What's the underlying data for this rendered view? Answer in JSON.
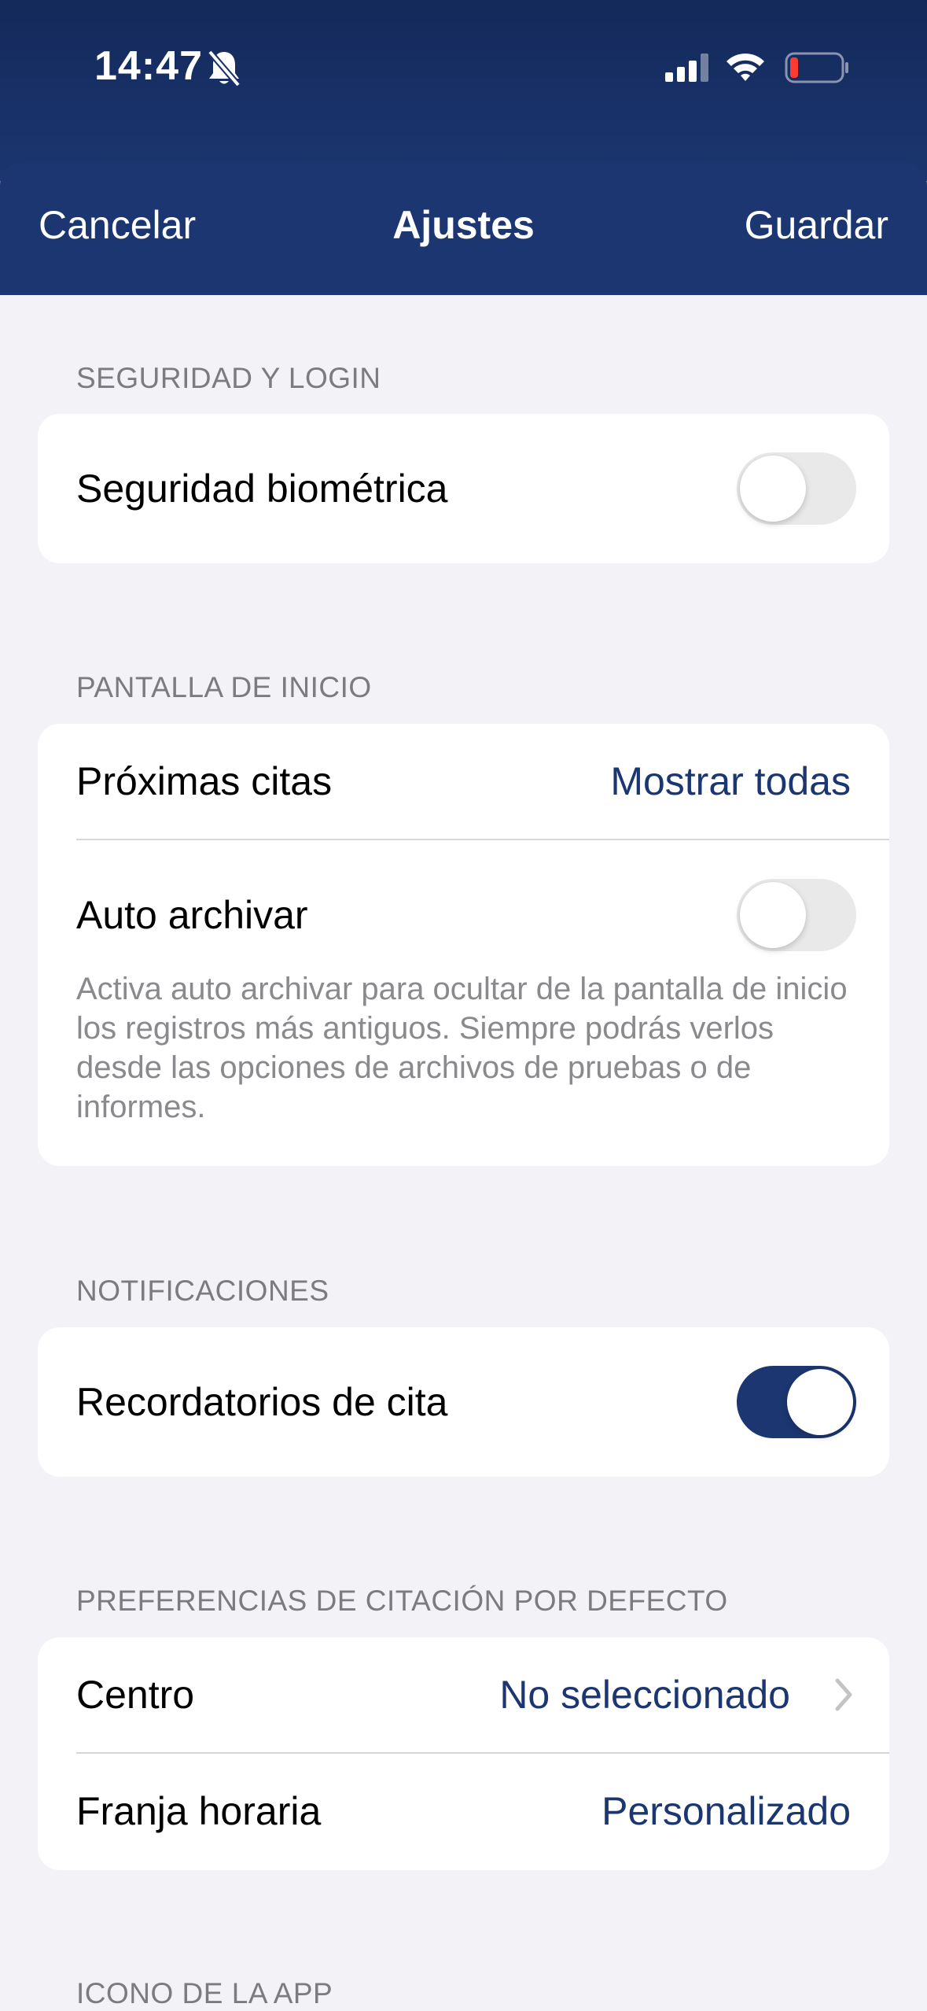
{
  "status_bar": {
    "time": "14:47"
  },
  "header": {
    "cancel_label": "Cancelar",
    "title": "Ajustes",
    "save_label": "Guardar"
  },
  "sections": {
    "security": {
      "label": "SEGURIDAD Y LOGIN",
      "biometric": {
        "label": "Seguridad biométrica",
        "enabled": false
      }
    },
    "home": {
      "label": "PANTALLA DE INICIO",
      "appointments": {
        "label": "Próximas citas",
        "value": "Mostrar todas"
      },
      "auto_archive": {
        "label": "Auto archivar",
        "enabled": false,
        "note": "Activa auto archivar para ocultar de la pantalla de inicio los registros más antiguos. Siempre podrás verlos desde las opciones de archivos de pruebas o de informes."
      }
    },
    "notifications": {
      "label": "NOTIFICACIONES",
      "reminders": {
        "label": "Recordatorios de cita",
        "enabled": true
      }
    },
    "defaults": {
      "label": "PREFERENCIAS DE CITACIÓN POR DEFECTO",
      "center": {
        "label": "Centro",
        "value": "No seleccionado"
      },
      "time_slot": {
        "label": "Franja horaria",
        "value": "Personalizado"
      }
    },
    "app_icon": {
      "label": "ICONO DE LA APP"
    }
  },
  "colors": {
    "accent": "#1b3670",
    "background": "#f2f2f7",
    "secondary_text": "#7b7b80"
  }
}
